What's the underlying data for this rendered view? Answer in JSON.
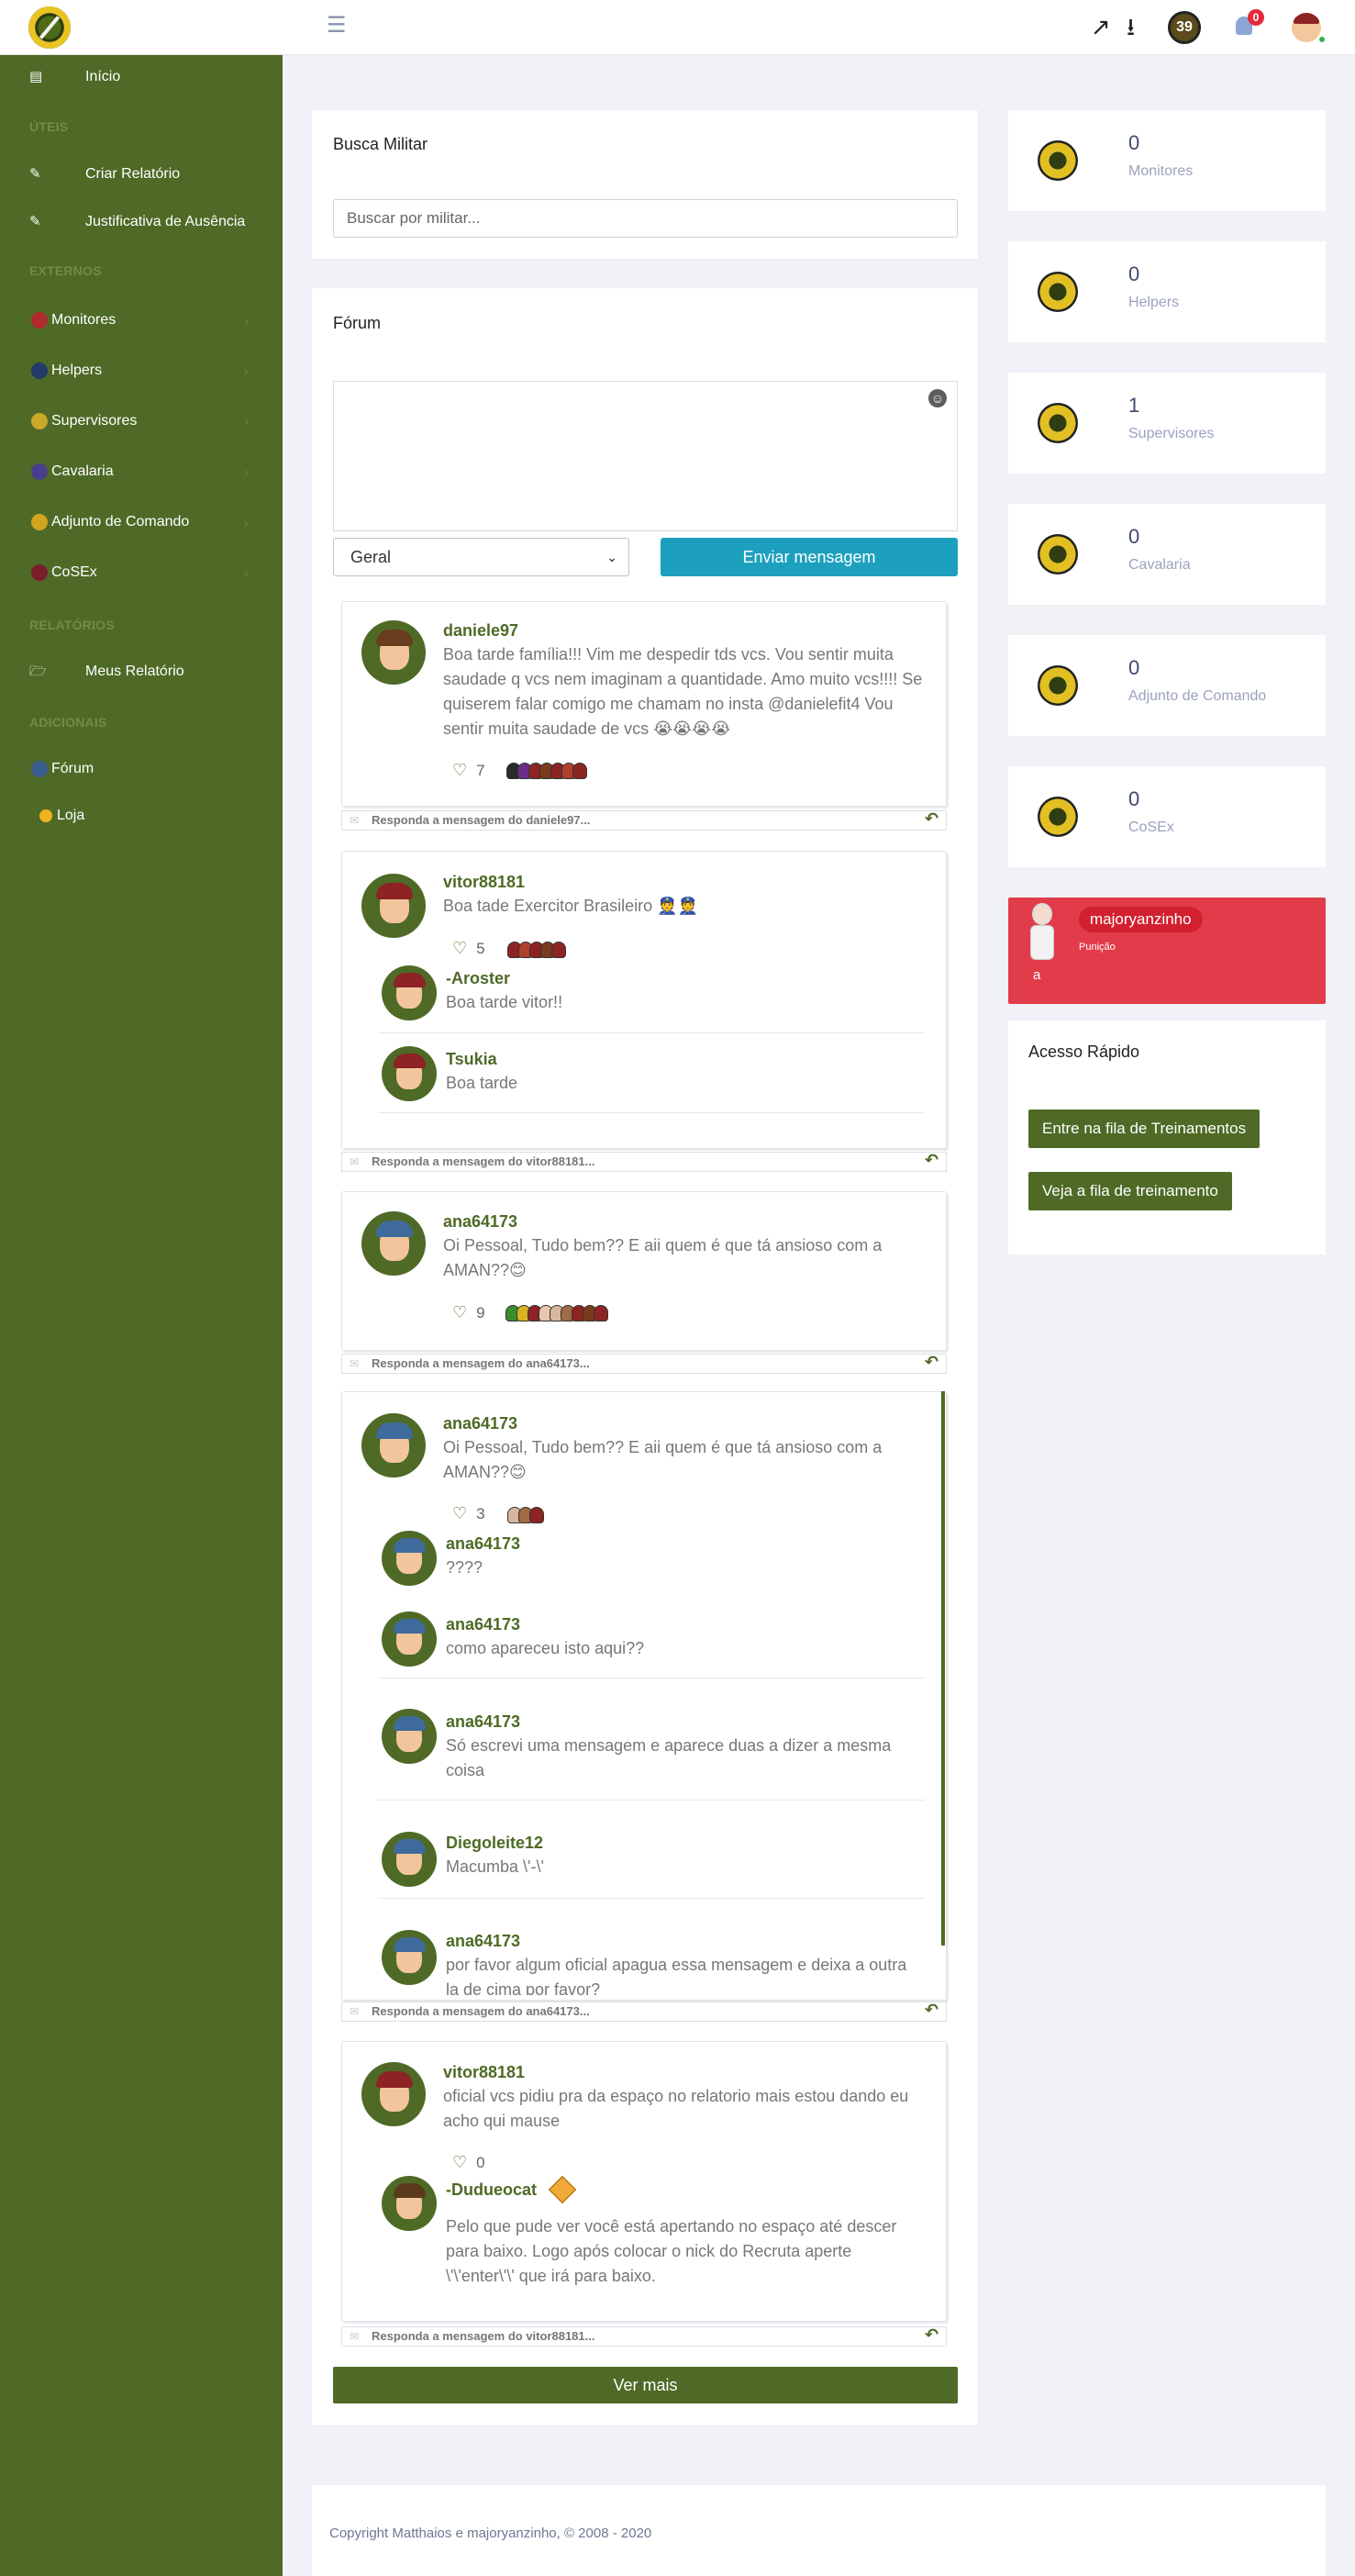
{
  "topbar": {
    "badge_count": "39",
    "notification_count": "0"
  },
  "sidebar": {
    "home": "Início",
    "section_uteis": "ÚTEIS",
    "criar_relatorio": "Criar Relatório",
    "justificativa": "Justificativa de Ausência",
    "section_externos": "EXTERNOS",
    "monitores": "Monitores",
    "helpers": "Helpers",
    "supervisores": "Supervisores",
    "cavalaria": "Cavalaria",
    "adjunto": "Adjunto de Comando",
    "cosex": "CoSEx",
    "section_relatorios": "RELATÓRIOS",
    "meus_relatorio": "Meus Relatório",
    "section_adicionais": "ADICIONAIS",
    "forum": "Fórum",
    "loja": "Loja"
  },
  "search": {
    "title": "Busca Militar",
    "placeholder": "Buscar por militar..."
  },
  "forum": {
    "title": "Fórum",
    "category": "Geral",
    "send_label": "Enviar mensagem",
    "more_label": "Ver mais",
    "posts": [
      {
        "user": "daniele97",
        "text": "Boa tarde família!!! Vim me despedir tds vcs. Vou sentir muita saudade q vcs nem imaginam a quantidade. Amo muito vcs!!!! Se quiserem falar comigo me chamam no insta @danielefit4 Vou sentir muita saudade de vcs 😭😭😭😭",
        "likes": "7",
        "reply": "Responda a mensagem do daniele97..."
      },
      {
        "user": "vitor88181",
        "text": "Boa tade Exercitor Brasileiro 👮👮",
        "likes": "5",
        "comments": [
          {
            "user": "-Aroster",
            "text": "Boa tarde vitor!!"
          },
          {
            "user": "Tsukia",
            "text": "Boa tarde"
          }
        ],
        "reply": "Responda a mensagem do vitor88181..."
      },
      {
        "user": "ana64173",
        "text": "Oi Pessoal, Tudo bem?? E aii quem é que tá ansioso com a AMAN??😊",
        "likes": "9",
        "reply": "Responda a mensagem do ana64173..."
      },
      {
        "user": "ana64173",
        "text": "Oi Pessoal, Tudo bem?? E aii quem é que tá ansioso com a AMAN??😊",
        "likes": "3",
        "comments": [
          {
            "user": "ana64173",
            "text": "????"
          },
          {
            "user": "ana64173",
            "text": "como apareceu isto aqui??"
          },
          {
            "user": "ana64173",
            "text": "Só escrevi uma mensagem e aparece duas a dizer a mesma coisa"
          },
          {
            "user": "Diegoleite12",
            "text": "Macumba \\'-\\'"
          },
          {
            "user": "ana64173",
            "text": "por favor algum oficial apagua essa mensagem e deixa a outra la de cima por favor?"
          }
        ],
        "reply": "Responda a mensagem do ana64173..."
      },
      {
        "user": "vitor88181",
        "text": "oficial vcs pidiu pra da espaço no relatorio mais estou dando eu acho qui mause",
        "likes": "0",
        "comments": [
          {
            "user": "-Dudueocat",
            "text": "Pelo que pude ver você está apertando no espaço até descer para baixo. Logo após colocar o nick do Recruta aperte \\'\\'enter\\'\\' que irá para baixo."
          }
        ],
        "reply": "Responda a mensagem do vitor88181..."
      }
    ]
  },
  "stats": [
    {
      "value": "0",
      "label": "Monitores"
    },
    {
      "value": "0",
      "label": "Helpers"
    },
    {
      "value": "1",
      "label": "Supervisores"
    },
    {
      "value": "0",
      "label": "Cavalaria"
    },
    {
      "value": "0",
      "label": "Adjunto de Comando"
    },
    {
      "value": "0",
      "label": "CoSEx"
    }
  ],
  "punishment": {
    "name": "majoryanzinho",
    "subtitle": "Punição",
    "text": "a"
  },
  "quick_access": {
    "title": "Acesso Rápido",
    "btn_queue": "Entre na fila de Treinamentos",
    "btn_view": "Veja a fila de treinamento"
  },
  "footer": {
    "copyright": "Copyright Matthaios e majoryanzinho, © 2008 - 2020"
  },
  "colors": {
    "brand_green": "#4e6a26",
    "send_blue": "#1da0bd",
    "punishment_red": "#e23c4a"
  }
}
